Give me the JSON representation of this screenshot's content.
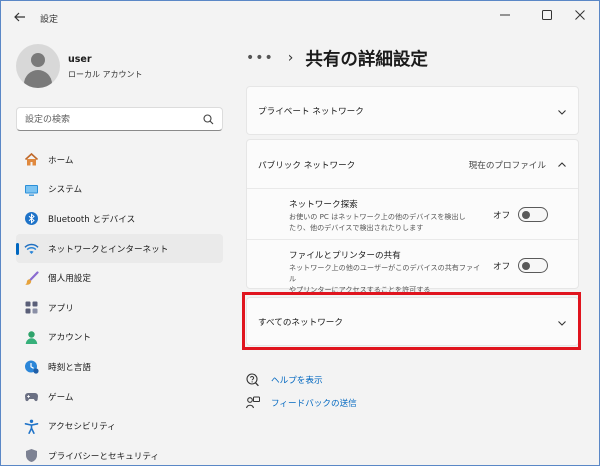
{
  "app": {
    "title": "設定"
  },
  "profile": {
    "name": "user",
    "account_type": "ローカル アカウント"
  },
  "search": {
    "placeholder": "設定の検索"
  },
  "nav": {
    "items": [
      {
        "label": "ホーム",
        "icon": "home-icon"
      },
      {
        "label": "システム",
        "icon": "system-icon"
      },
      {
        "label": "Bluetooth とデバイス",
        "icon": "bluetooth-icon"
      },
      {
        "label": "ネットワークとインターネット",
        "icon": "wifi-icon",
        "active": true
      },
      {
        "label": "個人用設定",
        "icon": "brush-icon"
      },
      {
        "label": "アプリ",
        "icon": "apps-icon"
      },
      {
        "label": "アカウント",
        "icon": "account-icon"
      },
      {
        "label": "時刻と言語",
        "icon": "time-language-icon"
      },
      {
        "label": "ゲーム",
        "icon": "gamepad-icon"
      },
      {
        "label": "アクセシビリティ",
        "icon": "accessibility-icon"
      },
      {
        "label": "プライバシーとセキュリティ",
        "icon": "shield-icon"
      }
    ]
  },
  "breadcrumb": {
    "dots": "•••",
    "separator": "›",
    "title": "共有の詳細設定"
  },
  "private_network": {
    "title": "プライベート ネットワーク"
  },
  "public_network": {
    "title": "パブリック ネットワーク",
    "current_profile": "現在のプロファイル",
    "network_discovery": {
      "title": "ネットワーク探索",
      "desc_1": "お使いの PC はネットワーク上の他のデバイスを検出し",
      "desc_2": "たり、他のデバイスで検出されたりします",
      "state": "オフ"
    },
    "file_printer_sharing": {
      "title": "ファイルとプリンターの共有",
      "desc_1": "ネットワーク上の他のユーザーがこのデバイスの共有ファイル",
      "desc_2": "やプリンターにアクセスすることを許可する",
      "state": "オフ"
    }
  },
  "all_networks": {
    "title": "すべてのネットワーク"
  },
  "links": {
    "help": "ヘルプを表示",
    "feedback": "フィードバックの送信"
  },
  "colors": {
    "accent": "#0067c0",
    "highlight": "#e0141e"
  }
}
